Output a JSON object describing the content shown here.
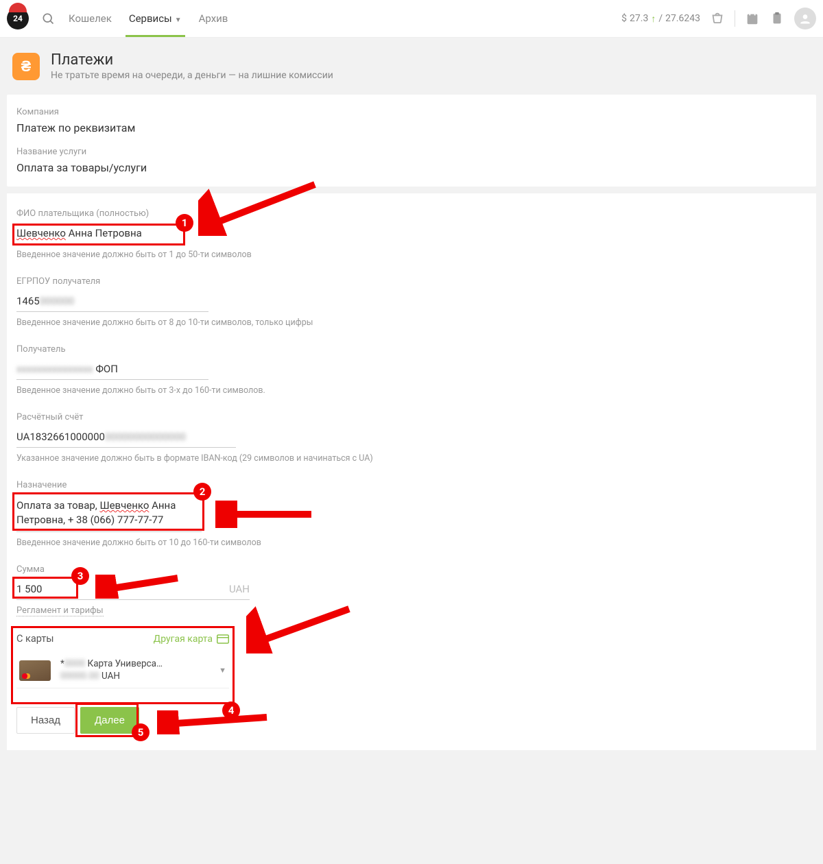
{
  "header": {
    "logo_text": "24",
    "nav": {
      "wallet": "Кошелек",
      "services": "Сервисы",
      "archive": "Архив"
    },
    "rate": {
      "currency": "$",
      "buy": "27.3",
      "sep": "/",
      "sell": "27.6243"
    }
  },
  "page": {
    "title": "Платежи",
    "subtitle": "Не тратьте время на очереди, а деньги — на лишние комиссии"
  },
  "info": {
    "company_label": "Компания",
    "company_value": "Платеж по реквизитам",
    "service_label": "Название услуги",
    "service_value": "Оплата за товары/услуги"
  },
  "form": {
    "payer": {
      "label": "ФИО плательщика (полностью)",
      "value_a": "Шевченко",
      "value_b": " Анна Петровна",
      "help": "Введенное значение должно быть от 1 до 50-ти символов"
    },
    "egrpou": {
      "label": "ЕГРПОУ получателя",
      "value": "1465",
      "help": "Введенное значение должно быть от 8 до 10-ти символов, только цифры"
    },
    "recipient": {
      "label": "Получатель",
      "suffix": " ФОП",
      "help": "Введенное значение должно быть от 3-х до 160-ти символов."
    },
    "account": {
      "label": "Расчётный счёт",
      "value": "UA1832661000000",
      "help": "Указанное значение должно быть в формате IBAN-код (29 символов и начинаться с UA)"
    },
    "purpose": {
      "label": "Назначение",
      "line1a": "Оплата за товар, ",
      "line1b": "Шевченко",
      "line1c": " Анна",
      "line2": "Петровна, + 38 (066) 777-77-77",
      "help": "Введенное значение должно быть от 10 до 160-ти символов"
    },
    "amount": {
      "label": "Сумма",
      "value": "1 500",
      "currency": "UAH",
      "link": "Регламент и тарифы"
    },
    "cardpick": {
      "title": "С карты",
      "other": "Другая карта",
      "card_mask_prefix": "*",
      "card_name": " Карта Универса…",
      "card_curr": " UAH"
    },
    "buttons": {
      "back": "Назад",
      "next": "Далее"
    }
  },
  "annotations": {
    "n1": "1",
    "n2": "2",
    "n3": "3",
    "n4": "4",
    "n5": "5"
  }
}
